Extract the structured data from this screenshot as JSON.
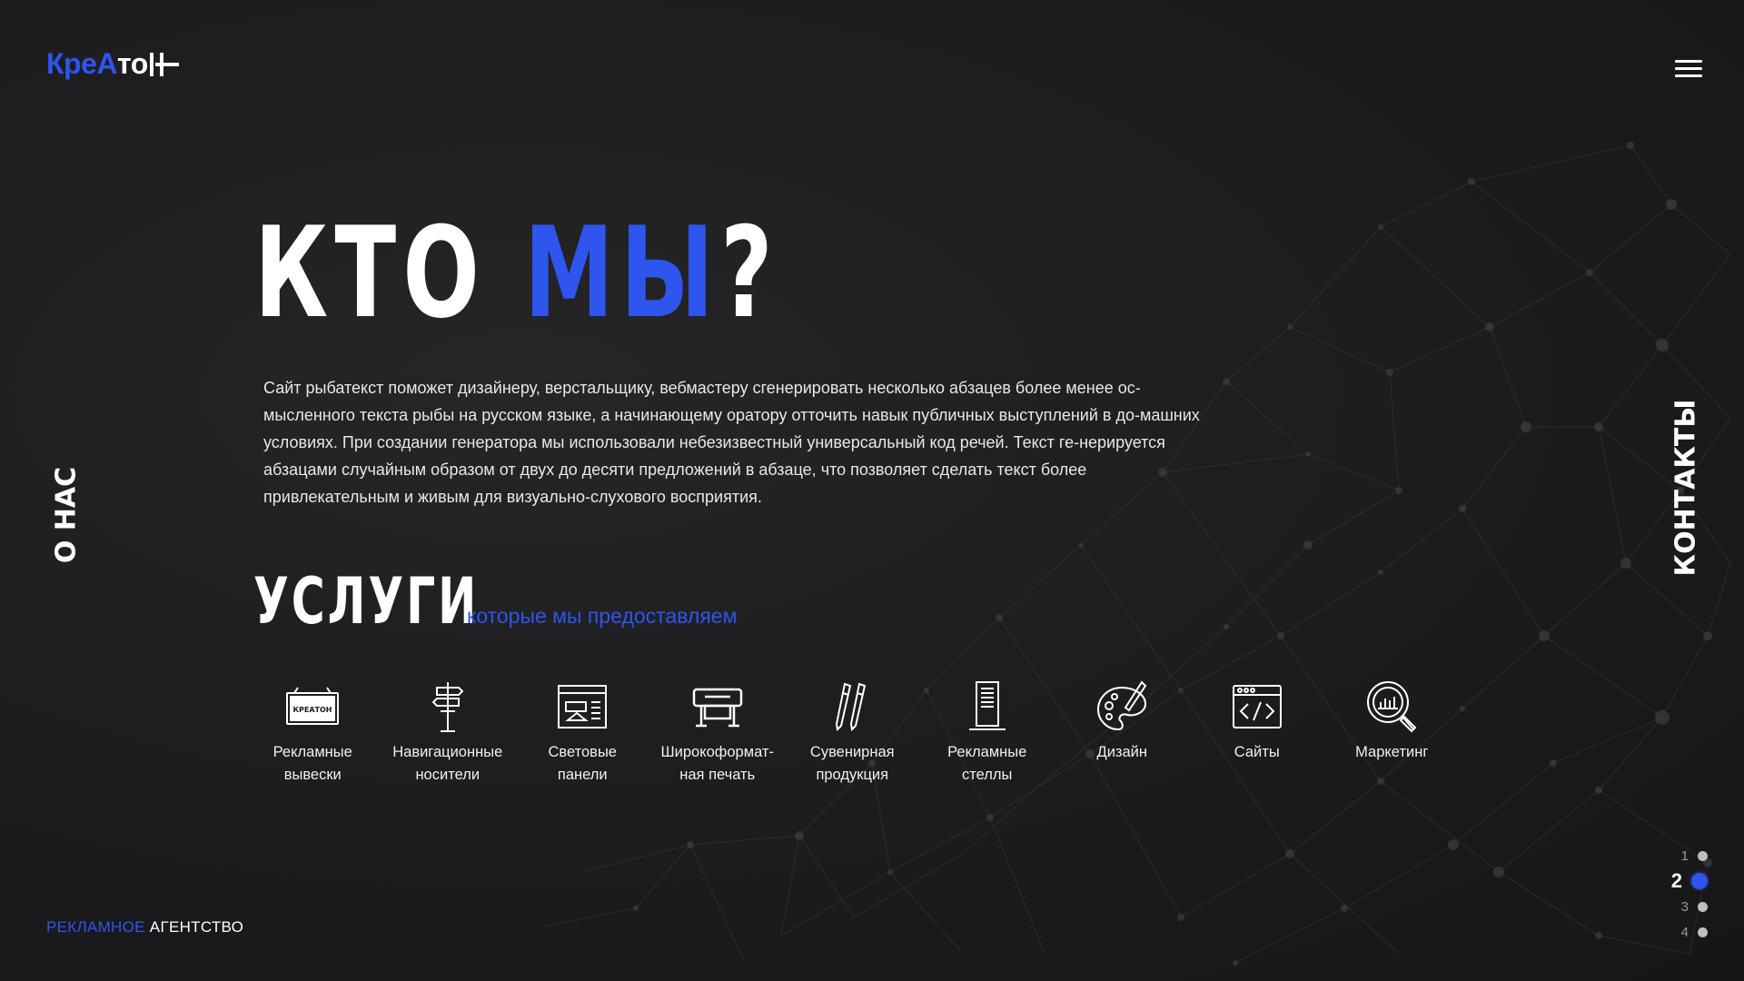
{
  "logo": {
    "part1": "Кре",
    "part2": "А",
    "part3": "то",
    "plus": "+"
  },
  "menu": {
    "icon": "hamburger-menu-icon"
  },
  "side_nav": {
    "left": "О НАС",
    "right": "КОНТАКТЫ"
  },
  "hero": {
    "title_white": "КТО ",
    "title_blue": "МЫ",
    "title_end": "?",
    "text": "Сайт рыбатекст поможет дизайнеру, верстальщику, вебмастеру сгенерировать несколько абзацев более менее ос-мысленного текста рыбы на русском языке, а начинающему оратору отточить навык публичных выступлений в до-машних условиях. При создании генератора мы использовали небезизвестный универсальный код речей. Текст ге-нерируется абзацами случайным образом от двух до десяти предложений в абзаце, что позволяет сделать текст более привлекательным и живым для визуально-слухового восприятия."
  },
  "services": {
    "title": "УСЛУГИ",
    "subtitle": "которые мы предоставляем",
    "items": [
      {
        "label": "Рекламные\nвывески",
        "icon": "signboard-icon",
        "sign_text": "КРЕАТОН"
      },
      {
        "label": "Навигационные\nносители",
        "icon": "signpost-icon"
      },
      {
        "label": "Световые\nпанели",
        "icon": "light-panel-icon"
      },
      {
        "label": "Широкоформат-\nная печать",
        "icon": "plotter-icon"
      },
      {
        "label": "Сувенирная\nпродукция",
        "icon": "pencils-icon"
      },
      {
        "label": "Рекламные\nстеллы",
        "icon": "stele-icon"
      },
      {
        "label": "Дизайн",
        "icon": "palette-icon"
      },
      {
        "label": "Сайты",
        "icon": "code-window-icon"
      },
      {
        "label": "Маркетинг",
        "icon": "magnifier-chart-icon"
      }
    ]
  },
  "footer": {
    "blue": "РЕКЛАМНОЕ",
    "white": " АГЕНТСТВО"
  },
  "pager": {
    "active": 2,
    "items": [
      "1",
      "2",
      "3",
      "4"
    ]
  },
  "colors": {
    "accent": "#2e55ee",
    "background": "#1d1d1f",
    "text": "#ffffff"
  }
}
